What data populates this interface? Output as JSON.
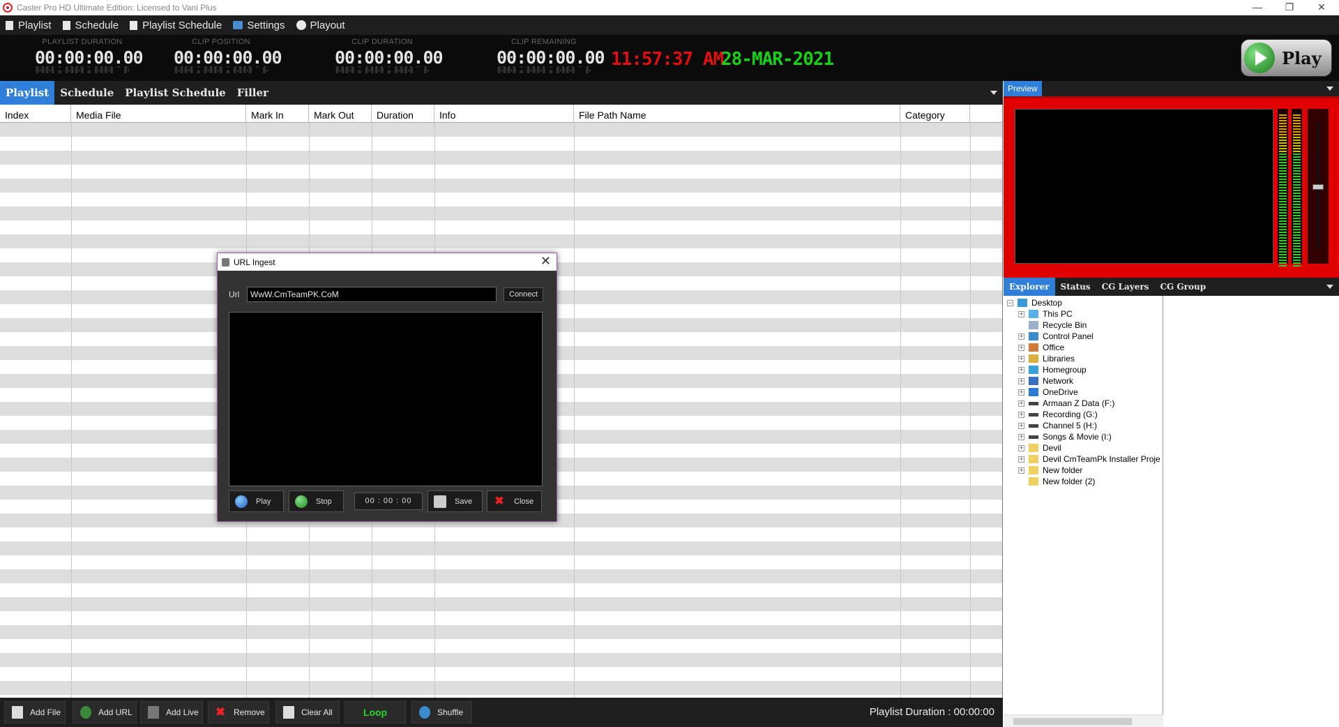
{
  "window": {
    "title": "Caster Pro HD Ultimate Edition: Licensed to Vani Plus",
    "minimize": "—",
    "restore": "❐",
    "close": "✕"
  },
  "menu": {
    "items": [
      "Playlist",
      "Schedule",
      "Playlist Schedule",
      "Settings",
      "Playout"
    ]
  },
  "timers": {
    "playlist_duration": {
      "label": "PLAYLIST DURATION",
      "value": "00:00:00.00"
    },
    "clip_position": {
      "label": "CLIP POSITION",
      "value": "00:00:00.00"
    },
    "clip_duration": {
      "label": "CLIP DURATION",
      "value": "00:00:00.00"
    },
    "clip_remaining": {
      "label": "CLIP REMAINING",
      "value": "00:00:00.00"
    },
    "clock": "11:57:37 AM",
    "date": "28-MAR-2021",
    "clock_color": "#e01010",
    "date_color": "#18d018"
  },
  "play_button": {
    "label": "Play",
    "color": "#1a9a1a"
  },
  "tabs": [
    "Playlist",
    "Schedule",
    "Playlist Schedule",
    "Filler"
  ],
  "grid": {
    "columns": [
      "Index",
      "Media File",
      "Mark In",
      "Mark Out",
      "Duration",
      "Info",
      "File Path Name",
      "Category"
    ],
    "row_alt_color": "#dedede"
  },
  "toolbar": {
    "add_file": "Add File",
    "add_url": "Add URL",
    "add_live": "Add Live",
    "remove": "Remove",
    "clear_all": "Clear All",
    "loop": "Loop",
    "shuffle": "Shuffle",
    "playlist_duration": "Playlist Duration : 00:00:00"
  },
  "preview": {
    "tab": "Preview",
    "accent": "#e00000"
  },
  "explorer_tabs": [
    "Explorer",
    "Status",
    "CG Layers",
    "CG Group"
  ],
  "tree": {
    "root": "Desktop",
    "items": [
      {
        "label": "This PC",
        "icon": "computer-icon"
      },
      {
        "label": "Recycle Bin",
        "icon": "recycle-bin-icon"
      },
      {
        "label": "Control Panel",
        "icon": "control-panel-icon"
      },
      {
        "label": "Office",
        "icon": "user-icon"
      },
      {
        "label": "Libraries",
        "icon": "libraries-icon"
      },
      {
        "label": "Homegroup",
        "icon": "homegroup-icon"
      },
      {
        "label": "Network",
        "icon": "network-icon"
      },
      {
        "label": "OneDrive",
        "icon": "cloud-icon"
      },
      {
        "label": "Armaan Z Data (F:)",
        "icon": "drive-icon"
      },
      {
        "label": "Recording (G:)",
        "icon": "drive-icon"
      },
      {
        "label": "Channel 5 (H:)",
        "icon": "drive-icon"
      },
      {
        "label": "Songs & Movie (I:)",
        "icon": "drive-icon"
      },
      {
        "label": "Devil",
        "icon": "folder-icon"
      },
      {
        "label": "Devil CmTeamPk Installer Proje",
        "icon": "folder-icon"
      },
      {
        "label": "New folder",
        "icon": "folder-icon"
      },
      {
        "label": "New folder (2)",
        "icon": "folder-icon"
      }
    ]
  },
  "dialog": {
    "title": "URL Ingest",
    "url_label": "Url",
    "url_value": "WwW.CmTeamPK.CoM",
    "connect": "Connect",
    "play": "Play",
    "stop": "Stop",
    "time": "00 : 00 : 00",
    "save": "Save",
    "close": "Close"
  }
}
